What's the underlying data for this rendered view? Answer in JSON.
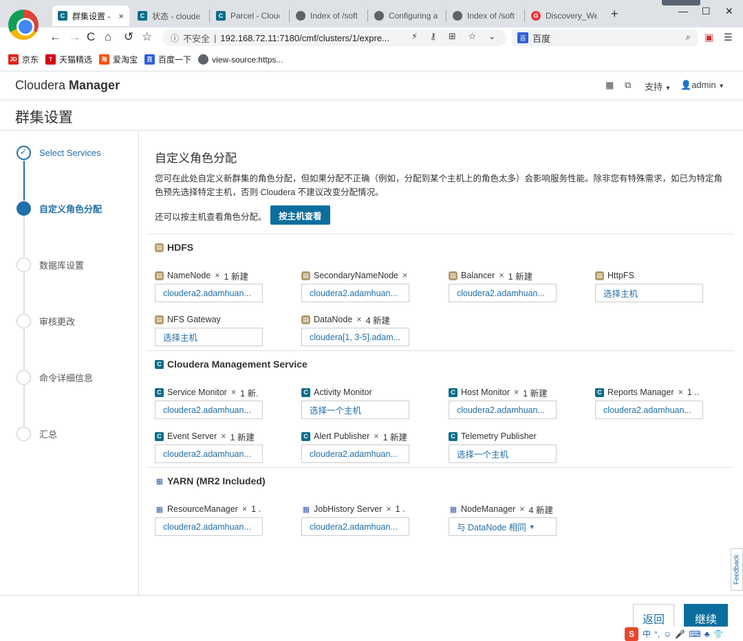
{
  "browser": {
    "tabs": [
      {
        "title": "群集设置 -",
        "close": "×",
        "icon": "cm"
      },
      {
        "title": "状态 - clouder",
        "icon": "cm"
      },
      {
        "title": "Parcel - Cloud",
        "icon": "cm"
      },
      {
        "title": "Index of /soft",
        "icon": "globe"
      },
      {
        "title": "Configuring a",
        "icon": "globe"
      },
      {
        "title": "Index of /soft",
        "icon": "globe"
      },
      {
        "title": "Discovery_We",
        "icon": "red"
      }
    ],
    "security_label": "不安全",
    "url": "192.168.72.11:7180/cmf/clusters/1/expre...",
    "search_engine": "百度",
    "bookmarks": [
      {
        "label": "京东",
        "badge": "JD",
        "color": "#e1251b"
      },
      {
        "label": "天猫精选",
        "badge": "T",
        "color": "#d40016"
      },
      {
        "label": "爱淘宝",
        "badge": "淘",
        "color": "#ff5000"
      },
      {
        "label": "百度一下",
        "badge": "百",
        "color": "#2f5fd6"
      },
      {
        "label": "view-source:https...",
        "badge": "◎",
        "color": "#5f6368"
      }
    ]
  },
  "app": {
    "logo_light": "Cloudera ",
    "logo_bold": "Manager",
    "support_label": "支持",
    "user_label": "admin",
    "page_title": "群集设置"
  },
  "steps": [
    {
      "label": "Select Services",
      "state": "done"
    },
    {
      "label": "自定义角色分配",
      "state": "current"
    },
    {
      "label": "数据库设置",
      "state": "todo"
    },
    {
      "label": "审核更改",
      "state": "todo"
    },
    {
      "label": "命令详细信息",
      "state": "todo"
    },
    {
      "label": "汇总",
      "state": "todo"
    }
  ],
  "main": {
    "section_title": "自定义角色分配",
    "description": "您可在此处自定义新群集的角色分配，但如果分配不正确（例如，分配到某个主机上的角色太多）会影响服务性能。除非您有特殊需求，如已为特定角色预先选择特定主机，否则 Cloudera 不建议改变分配情况。",
    "byhost_label": "还可以按主机查看角色分配。",
    "byhost_button": "按主机查看"
  },
  "services": [
    {
      "name": "HDFS",
      "icon": "hdfs",
      "roles": [
        {
          "name": "NameNode",
          "x": "×",
          "count": "1 新建",
          "value": "cloudera2.adamhuan..."
        },
        {
          "name": "SecondaryNameNode",
          "x": "×",
          "count": "",
          "value": "cloudera2.adamhuan..."
        },
        {
          "name": "Balancer",
          "x": "×",
          "count": "1 新建",
          "value": "cloudera2.adamhuan..."
        },
        {
          "name": "HttpFS",
          "x": "",
          "count": "",
          "value": "选择主机"
        },
        {
          "name": "NFS Gateway",
          "x": "",
          "count": "",
          "value": "选择主机"
        },
        {
          "name": "DataNode",
          "x": "×",
          "count": "4 新建",
          "value": "cloudera[1, 3-5].adam..."
        }
      ]
    },
    {
      "name": "Cloudera Management Service",
      "icon": "cm",
      "roles": [
        {
          "name": "Service Monitor",
          "x": "×",
          "count": "1 新.",
          "value": "cloudera2.adamhuan..."
        },
        {
          "name": "Activity Monitor",
          "x": "",
          "count": "",
          "value": "选择一个主机"
        },
        {
          "name": "Host Monitor",
          "x": "×",
          "count": "1 新建",
          "value": "cloudera2.adamhuan..."
        },
        {
          "name": "Reports Manager",
          "x": "×",
          "count": "1 ..",
          "value": "cloudera2.adamhuan..."
        },
        {
          "name": "Event Server",
          "x": "×",
          "count": "1 新建",
          "value": "cloudera2.adamhuan..."
        },
        {
          "name": "Alert Publisher",
          "x": "×",
          "count": "1 新建",
          "value": "cloudera2.adamhuan..."
        },
        {
          "name": "Telemetry Publisher",
          "x": "",
          "count": "",
          "value": "选择一个主机"
        }
      ]
    },
    {
      "name": "YARN (MR2 Included)",
      "icon": "yarn",
      "roles": [
        {
          "name": "ResourceManager",
          "x": "×",
          "count": "1 .",
          "value": "cloudera2.adamhuan..."
        },
        {
          "name": "JobHistory Server",
          "x": "×",
          "count": "1 .",
          "value": "cloudera2.adamhuan..."
        },
        {
          "name": "NodeManager",
          "x": "×",
          "count": "4 新建",
          "value": "与 DataNode 相同",
          "dropdown": true
        }
      ]
    }
  ],
  "feedback_label": "Feedback",
  "footer": {
    "back_label": "返回",
    "next_label": "继续"
  },
  "colors": {
    "accent": "#1f6fa8",
    "primary_button": "#0b6e9e"
  }
}
